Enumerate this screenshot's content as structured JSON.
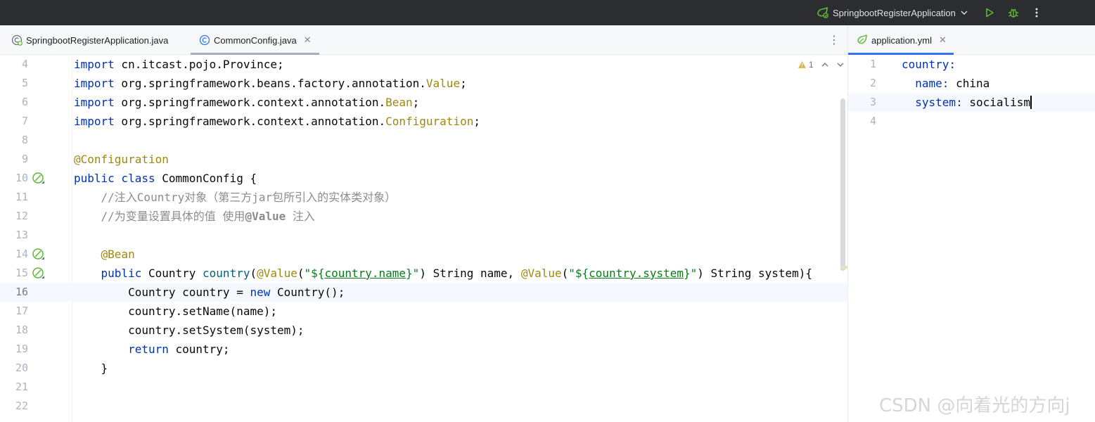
{
  "toolbar": {
    "run_config": "SpringbootRegisterApplication",
    "icons": [
      "spring-boot-icon",
      "chevron-down-icon",
      "run-icon",
      "debug-icon",
      "more-vert-icon"
    ]
  },
  "tabs_left": [
    {
      "label": "SpringbootRegisterApplication.java",
      "icon": "spring-class-icon"
    },
    {
      "label": "CommonConfig.java",
      "icon": "class-icon"
    }
  ],
  "tabs_right": [
    {
      "label": "application.yml",
      "icon": "yaml-spring-icon"
    }
  ],
  "inspection": {
    "count": "1"
  },
  "java_lines": [
    {
      "n": "4",
      "code": "import cn.itcast.pojo.Province;"
    },
    {
      "n": "5",
      "code": "import org.springframework.beans.factory.annotation.Value;"
    },
    {
      "n": "6",
      "code": "import org.springframework.context.annotation.Bean;"
    },
    {
      "n": "7",
      "code": "import org.springframework.context.annotation.Configuration;"
    },
    {
      "n": "8",
      "code": ""
    },
    {
      "n": "9",
      "code": "@Configuration"
    },
    {
      "n": "10",
      "code": "public class CommonConfig {"
    },
    {
      "n": "11",
      "code": "    //注入Country对象（第三方jar包所引入的实体类对象）"
    },
    {
      "n": "12",
      "code": "    //为变量设置具体的值 使用@Value 注入"
    },
    {
      "n": "13",
      "code": ""
    },
    {
      "n": "14",
      "code": "    @Bean"
    },
    {
      "n": "15",
      "code": "    public Country country(@Value(\"${country.name}\") String name, @Value(\"${country.system}\") String system){"
    },
    {
      "n": "16",
      "code": "        Country country = new Country();"
    },
    {
      "n": "17",
      "code": "        country.setName(name);"
    },
    {
      "n": "18",
      "code": "        country.setSystem(system);"
    },
    {
      "n": "19",
      "code": "        return country;"
    },
    {
      "n": "20",
      "code": "    }"
    },
    {
      "n": "21",
      "code": ""
    },
    {
      "n": "22",
      "code": ""
    }
  ],
  "yaml_lines": [
    {
      "n": "1",
      "code": "country:"
    },
    {
      "n": "2",
      "code": "  name: china"
    },
    {
      "n": "3",
      "code": "  system: socialism"
    },
    {
      "n": "4",
      "code": ""
    }
  ],
  "watermark": "CSDN @向着光的方向j"
}
